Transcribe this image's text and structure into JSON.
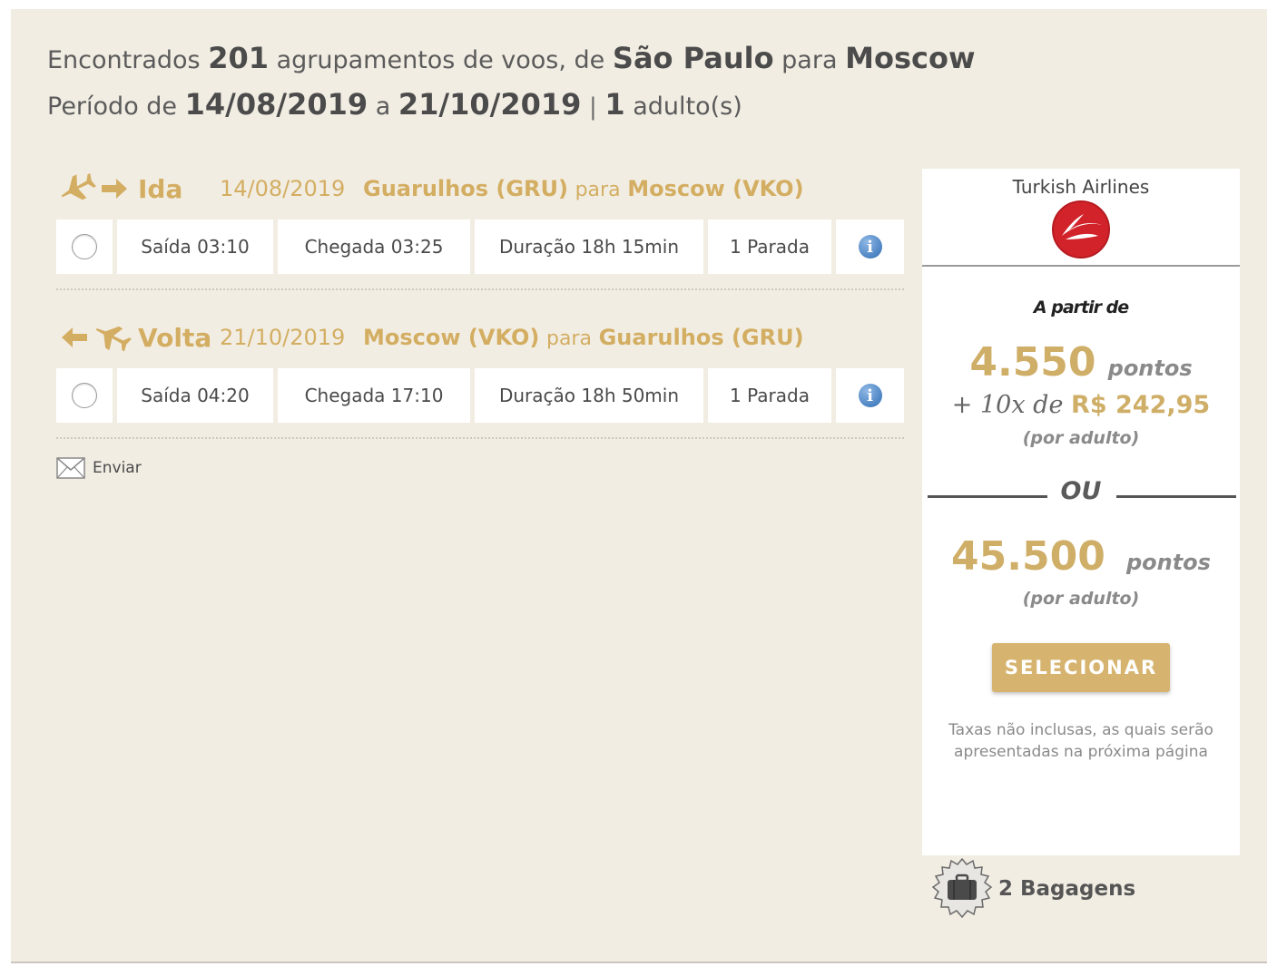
{
  "summary": {
    "found_prefix": "Encontrados",
    "count": "201",
    "found_mid": "agrupamentos de voos, de",
    "origin": "São Paulo",
    "para": "para",
    "destination": "Moscow",
    "period_prefix": "Período de",
    "start_date": "14/08/2019",
    "a": "a",
    "end_date": "21/10/2019",
    "separator": "|",
    "adults": "1",
    "adults_suffix": "adulto(s)"
  },
  "outbound": {
    "label": "Ida",
    "date": "14/08/2019",
    "from": "Guarulhos (GRU)",
    "para": "para",
    "to": "Moscow (VKO)",
    "departure": "Saída 03:10",
    "arrival": "Chegada 03:25",
    "duration": "Duração 18h 15min",
    "stops": "1 Parada",
    "info": "i"
  },
  "inbound": {
    "label": "Volta",
    "date": "21/10/2019",
    "from": "Moscow (VKO)",
    "para": "para",
    "to": "Guarulhos (GRU)",
    "departure": "Saída 04:20",
    "arrival": "Chegada 17:10",
    "duration": "Duração 18h 50min",
    "stops": "1 Parada",
    "info": "i"
  },
  "send_label": "Enviar",
  "offer": {
    "airline": "Turkish Airlines",
    "from_label": "A partir de",
    "points_1": "4.550",
    "points_unit": "pontos",
    "plus_text": "+ 10x de",
    "money": "R$ 242,95",
    "per_adult": "(por adulto)",
    "or": "OU",
    "points_2": "45.500",
    "select": "SELECIONAR",
    "fees_line1": "Taxas não inclusas, as quais serão",
    "fees_line2": "apresentadas na próxima página"
  },
  "bags_label": "2 Bagagens",
  "colors": {
    "background": "#f2ede3",
    "gold": "#d3ae62",
    "text": "#4a4a4a",
    "info_blue": "#2f6db3",
    "turkish_red": "#d2232a"
  }
}
